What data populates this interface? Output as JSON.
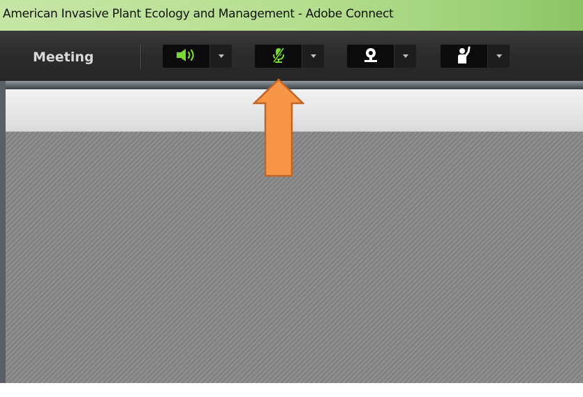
{
  "window": {
    "title": "American Invasive Plant Ecology and Management - Adobe Connect"
  },
  "toolbar": {
    "meeting_menu_label": "Meeting",
    "buttons": [
      {
        "name": "speaker",
        "icon": "speaker-icon",
        "state": "on",
        "color": "#7ad832"
      },
      {
        "name": "microphone",
        "icon": "microphone-muted-icon",
        "state": "muted",
        "color": "#7ad832"
      },
      {
        "name": "webcam",
        "icon": "webcam-icon",
        "state": "off",
        "color": "#ffffff"
      },
      {
        "name": "raise-hand",
        "icon": "raise-hand-icon",
        "state": "off",
        "color": "#ffffff"
      }
    ]
  },
  "annotation": {
    "arrow_color": "#f79646",
    "arrow_target": "microphone"
  },
  "colors": {
    "titlebar_accent": "#b4dd8d",
    "toolbar_bg": "#2b2b2b",
    "active_green": "#7ad832",
    "arrow_fill": "#f79646",
    "arrow_stroke": "#c0652a"
  }
}
